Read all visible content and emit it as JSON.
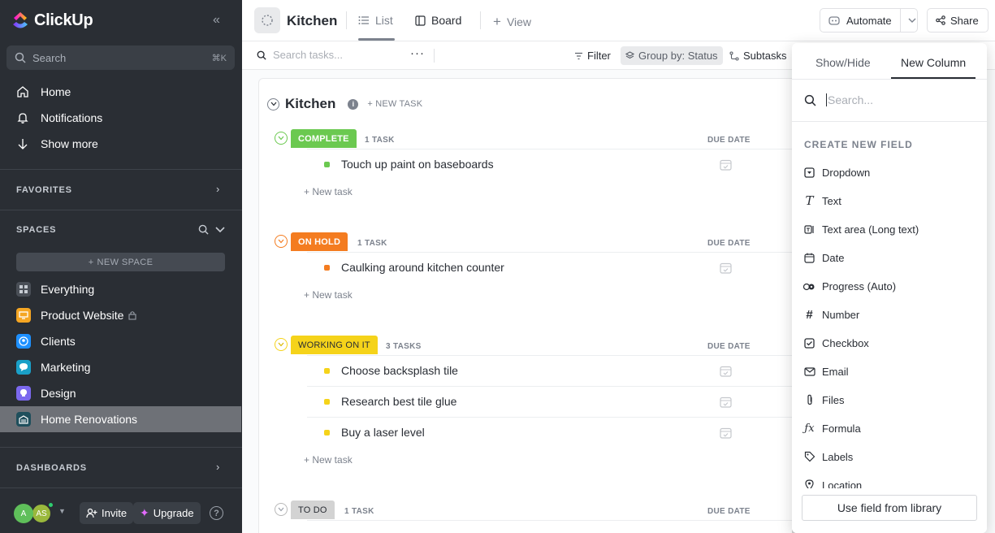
{
  "app": {
    "name": "ClickUp"
  },
  "sidebar": {
    "search": {
      "placeholder": "Search",
      "shortcut": "⌘K"
    },
    "nav": [
      {
        "label": "Home",
        "icon": "home-icon"
      },
      {
        "label": "Notifications",
        "icon": "bell-icon"
      },
      {
        "label": "Show more",
        "icon": "arrow-down-icon"
      }
    ],
    "favorites_label": "FAVORITES",
    "spaces_label": "SPACES",
    "new_space_label": "NEW SPACE",
    "spaces": [
      {
        "label": "Everything",
        "color": "#4a4f57",
        "icon": "grid-icon"
      },
      {
        "label": "Product Website",
        "color": "#f5a623",
        "icon": "monitor-icon",
        "locked": true
      },
      {
        "label": "Clients",
        "color": "#1e90ff",
        "icon": "person-icon"
      },
      {
        "label": "Marketing",
        "color": "#1aa0c8",
        "icon": "chat-icon"
      },
      {
        "label": "Design",
        "color": "#7b68ee",
        "icon": "bulb-icon"
      },
      {
        "label": "Home Renovations",
        "color": "#1f4f5c",
        "icon": "garage-icon",
        "active": true
      }
    ],
    "dashboards_label": "DASHBOARDS",
    "footer": {
      "avatar_a": "A",
      "avatar_as": "AS",
      "invite_label": "Invite",
      "upgrade_label": "Upgrade"
    }
  },
  "topbar": {
    "title": "Kitchen",
    "views": [
      {
        "label": "List",
        "active": true
      },
      {
        "label": "Board"
      },
      {
        "label": "View",
        "prefix": "+"
      }
    ],
    "automate_label": "Automate",
    "share_label": "Share"
  },
  "toolbar": {
    "search_placeholder": "Search tasks...",
    "filter_label": "Filter",
    "group_label": "Group by: Status",
    "subtasks_label": "Subtasks"
  },
  "list": {
    "title": "Kitchen",
    "new_task_header": "+ NEW TASK",
    "due_date_label": "DUE DATE",
    "new_task_label": "+ New task",
    "groups": [
      {
        "status": "COMPLETE",
        "color": "#6bc950",
        "count": "1 TASK",
        "tasks": [
          "Touch up paint on baseboards"
        ]
      },
      {
        "status": "ON HOLD",
        "color": "#f47c20",
        "count": "1 TASK",
        "tasks": [
          "Caulking around kitchen counter"
        ]
      },
      {
        "status": "WORKING ON IT",
        "color": "#f5d31a",
        "text_color": "#292d34",
        "count": "3 TASKS",
        "tasks": [
          "Choose backsplash tile",
          "Research best tile glue",
          "Buy a laser level"
        ]
      },
      {
        "status": "TO DO",
        "color": "#d3d3d3",
        "text_color": "#292d34",
        "count": "1 TASK",
        "tasks": []
      }
    ]
  },
  "panel": {
    "tabs": [
      "Show/Hide",
      "New Column"
    ],
    "active_tab": "New Column",
    "search_placeholder": "Search...",
    "heading": "CREATE NEW FIELD",
    "fields": [
      {
        "label": "Dropdown",
        "icon": "dropdown-icon"
      },
      {
        "label": "Text",
        "icon": "text-icon"
      },
      {
        "label": "Text area (Long text)",
        "icon": "textarea-icon"
      },
      {
        "label": "Date",
        "icon": "calendar-icon"
      },
      {
        "label": "Progress (Auto)",
        "icon": "progress-icon"
      },
      {
        "label": "Number",
        "icon": "hash-icon"
      },
      {
        "label": "Checkbox",
        "icon": "checkbox-icon"
      },
      {
        "label": "Email",
        "icon": "email-icon"
      },
      {
        "label": "Files",
        "icon": "paperclip-icon"
      },
      {
        "label": "Formula",
        "icon": "formula-icon"
      },
      {
        "label": "Labels",
        "icon": "tag-icon"
      },
      {
        "label": "Location",
        "icon": "location-icon"
      }
    ],
    "library_button": "Use field from library"
  }
}
